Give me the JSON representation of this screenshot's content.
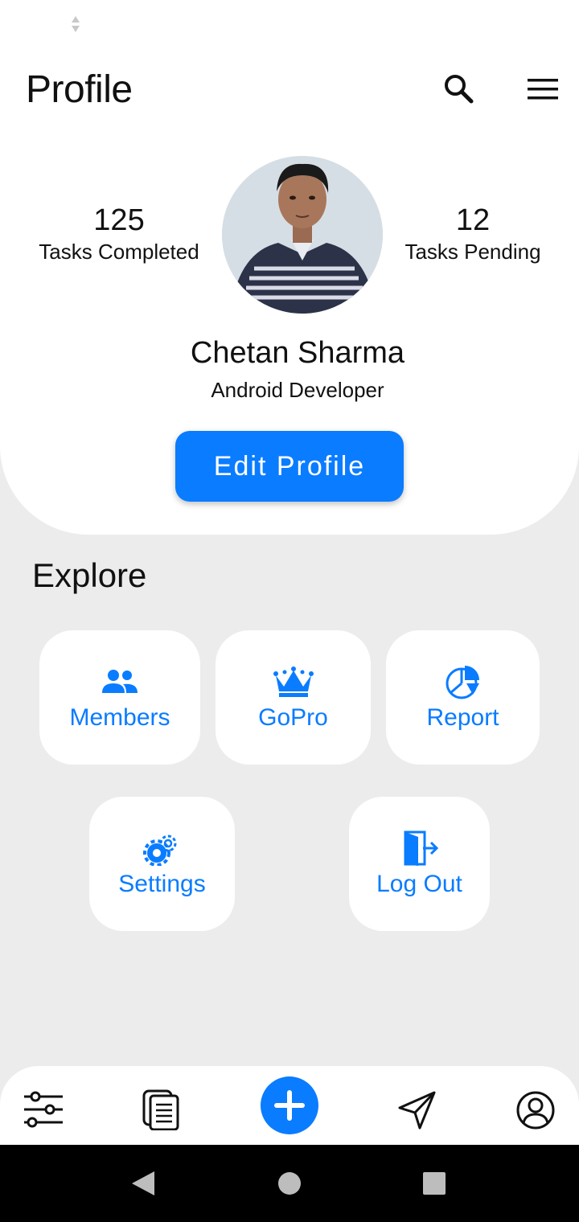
{
  "header": {
    "title": "Profile",
    "search_icon": "search-icon",
    "menu_icon": "hamburger-menu-icon"
  },
  "profile": {
    "tasks_completed": {
      "value": "125",
      "label": "Tasks Completed"
    },
    "tasks_pending": {
      "value": "12",
      "label": "Tasks Pending"
    },
    "name": "Chetan Sharma",
    "role": "Android Developer",
    "edit_button": "Edit Profile"
  },
  "explore": {
    "title": "Explore",
    "tiles": [
      {
        "label": "Members",
        "icon": "people-icon"
      },
      {
        "label": "GoPro",
        "icon": "crown-icon"
      },
      {
        "label": "Report",
        "icon": "pie-chart-icon"
      },
      {
        "label": "Settings",
        "icon": "gears-icon"
      },
      {
        "label": "Log Out",
        "icon": "door-exit-icon"
      }
    ]
  },
  "bottom_nav": {
    "items": [
      {
        "icon": "sliders-icon"
      },
      {
        "icon": "documents-icon"
      },
      {
        "icon": "plus-icon"
      },
      {
        "icon": "send-icon"
      },
      {
        "icon": "user-circle-icon"
      }
    ]
  },
  "colors": {
    "accent": "#0a7cff",
    "background": "#ececec",
    "card": "#ffffff"
  }
}
